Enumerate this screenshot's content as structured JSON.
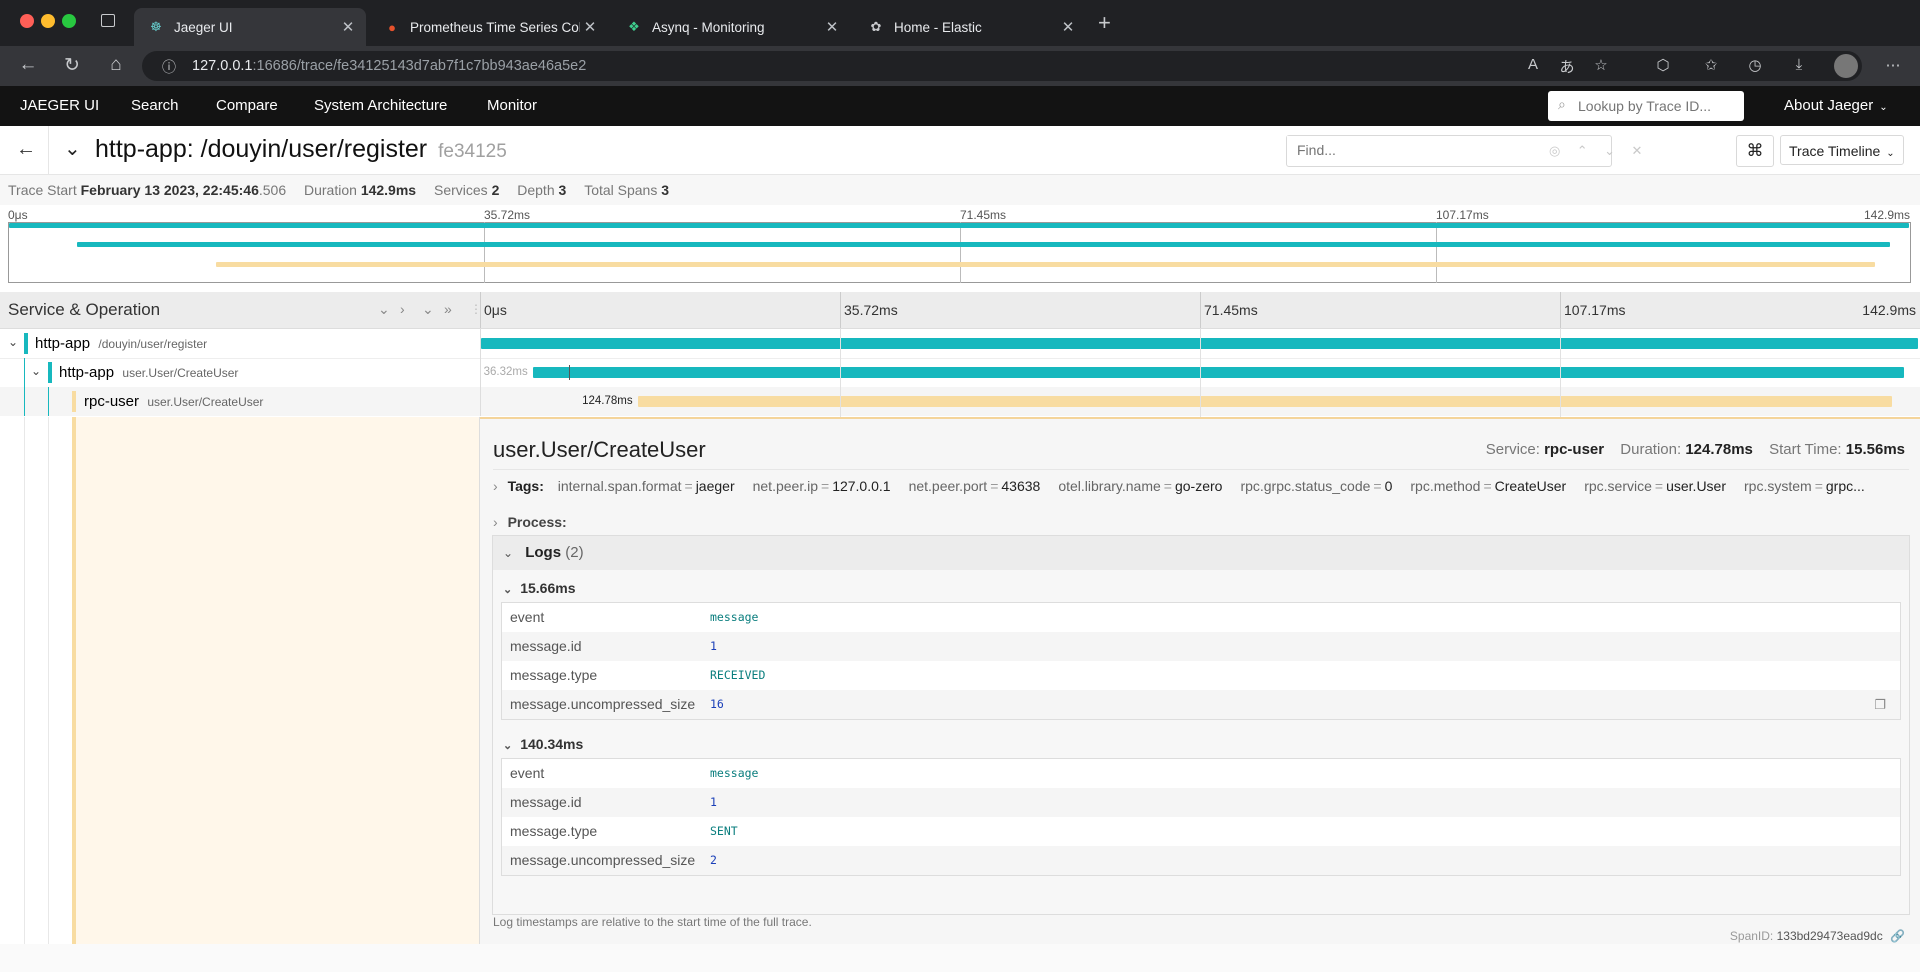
{
  "browser": {
    "tabs": [
      {
        "title": "Jaeger UI",
        "active": true
      },
      {
        "title": "Prometheus Time Series Collec",
        "active": false
      },
      {
        "title": "Asynq - Monitoring",
        "active": false
      },
      {
        "title": "Home - Elastic",
        "active": false
      }
    ],
    "url_host": "127.0.0.1",
    "url_rest": ":16686/trace/fe34125143d7ab7f1c7bb943ae46a5e2"
  },
  "nav": {
    "brand": "JAEGER UI",
    "links": [
      "Search",
      "Compare",
      "System Architecture",
      "Monitor"
    ],
    "lookup_placeholder": "Lookup by Trace ID...",
    "about": "About Jaeger"
  },
  "trace": {
    "title": "http-app: /douyin/user/register",
    "short_id": "fe34125",
    "find_placeholder": "Find...",
    "view_select": "Trace Timeline",
    "summary": {
      "trace_start_label": "Trace Start",
      "trace_start_value": "February 13 2023, 22:45:46",
      "trace_start_ms": ".506",
      "duration_label": "Duration",
      "duration_value": "142.9ms",
      "services_label": "Services",
      "services_value": "2",
      "depth_label": "Depth",
      "depth_value": "3",
      "total_spans_label": "Total Spans",
      "total_spans_value": "3"
    },
    "ticks": [
      "0μs",
      "35.72ms",
      "71.45ms",
      "107.17ms",
      "142.9ms"
    ]
  },
  "timeline": {
    "header_label": "Service & Operation",
    "spans": [
      {
        "service": "http-app",
        "operation": "/douyin/user/register",
        "color": "#17b8be",
        "start": 0,
        "end": 1.0,
        "label": ""
      },
      {
        "service": "http-app",
        "operation": "user.User/CreateUser",
        "color": "#17b8be",
        "start": 0.036,
        "end": 0.99,
        "label": "36.32ms"
      },
      {
        "service": "rpc-user",
        "operation": "user.User/CreateUser",
        "color": "#f8dca1",
        "start": 0.109,
        "end": 0.982,
        "label": "124.78ms"
      }
    ]
  },
  "detail": {
    "operation": "user.User/CreateUser",
    "service_label": "Service:",
    "service_value": "rpc-user",
    "duration_label": "Duration:",
    "duration_value": "124.78ms",
    "start_label": "Start Time:",
    "start_value": "15.56ms",
    "tags_label": "Tags:",
    "tags": [
      {
        "key": "internal.span.format",
        "value": "jaeger"
      },
      {
        "key": "net.peer.ip",
        "value": "127.0.0.1"
      },
      {
        "key": "net.peer.port",
        "value": "43638"
      },
      {
        "key": "otel.library.name",
        "value": "go-zero"
      },
      {
        "key": "rpc.grpc.status_code",
        "value": "0"
      },
      {
        "key": "rpc.method",
        "value": "CreateUser"
      },
      {
        "key": "rpc.service",
        "value": "user.User"
      },
      {
        "key": "rpc.system",
        "value": "grpc..."
      }
    ],
    "process_label": "Process:",
    "logs_label": "Logs",
    "logs_count": "(2)",
    "logs": [
      {
        "time": "15.66ms",
        "fields": [
          {
            "key": "event",
            "value": "message",
            "type": "str"
          },
          {
            "key": "message.id",
            "value": "1",
            "type": "num"
          },
          {
            "key": "message.type",
            "value": "RECEIVED",
            "type": "str"
          },
          {
            "key": "message.uncompressed_size",
            "value": "16",
            "type": "num"
          }
        ]
      },
      {
        "time": "140.34ms",
        "fields": [
          {
            "key": "event",
            "value": "message",
            "type": "str"
          },
          {
            "key": "message.id",
            "value": "1",
            "type": "num"
          },
          {
            "key": "message.type",
            "value": "SENT",
            "type": "str"
          },
          {
            "key": "message.uncompressed_size",
            "value": "2",
            "type": "num"
          }
        ]
      }
    ],
    "log_note": "Log timestamps are relative to the start time of the full trace.",
    "span_id_label": "SpanID:",
    "span_id_value": "133bd29473ead9dc"
  }
}
